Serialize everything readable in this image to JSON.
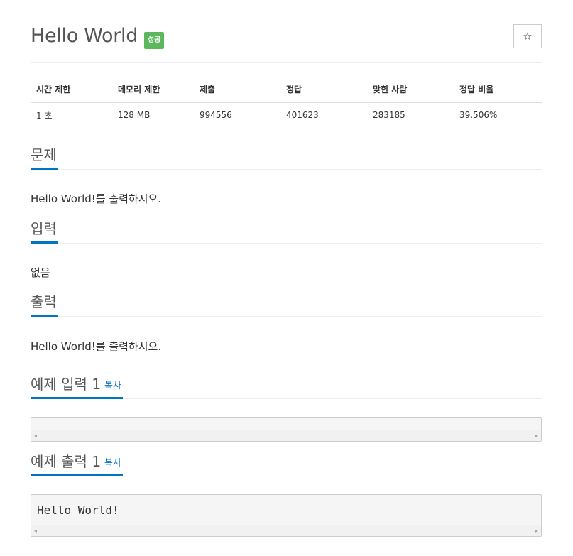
{
  "problem": {
    "title": "Hello World",
    "badge": "성공",
    "star_icon": "☆"
  },
  "info_table": {
    "headers": [
      "시간 제한",
      "메모리 제한",
      "제출",
      "정답",
      "맞힌 사람",
      "정답 비율"
    ],
    "row": [
      "1 초",
      "128 MB",
      "994556",
      "401623",
      "283185",
      "39.506%"
    ]
  },
  "sections": {
    "problem": {
      "heading": "문제",
      "body": "Hello World!를 출력하시오."
    },
    "input": {
      "heading": "입력",
      "body": "없음"
    },
    "output": {
      "heading": "출력",
      "body": "Hello World!를 출력하시오."
    },
    "sample_input": {
      "heading": "예제 입력 1",
      "copy": "복사",
      "content": ""
    },
    "sample_output": {
      "heading": "예제 출력 1",
      "copy": "복사",
      "content": "Hello World!"
    }
  },
  "icons": {
    "scroll_left": "◂",
    "scroll_right": "▸"
  },
  "colors": {
    "accent": "#0076c0",
    "badge": "#5cb85c"
  }
}
